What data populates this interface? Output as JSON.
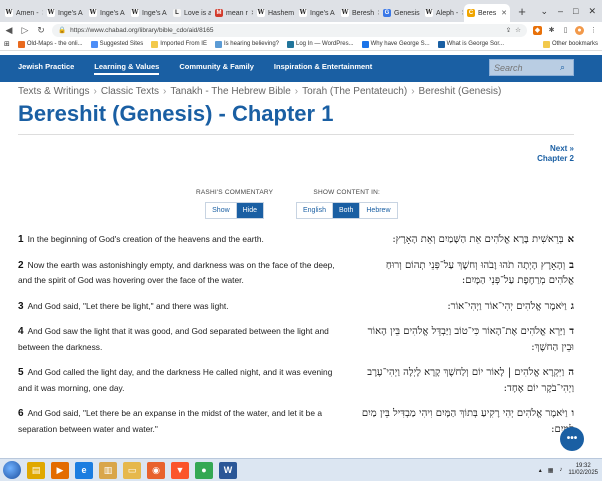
{
  "browser": {
    "tabs": [
      {
        "label": "Amen -",
        "color": "#ffffff",
        "glyph": "W"
      },
      {
        "label": "Inge's A",
        "color": "#ffffff",
        "glyph": "W"
      },
      {
        "label": "Inge's A",
        "color": "#ffffff",
        "glyph": "W"
      },
      {
        "label": "Inge's A",
        "color": "#ffffff",
        "glyph": "W"
      },
      {
        "label": "Love is a",
        "color": "#f5f5f5",
        "glyph": "L"
      },
      {
        "label": "mean r",
        "color": "#d23a2b",
        "glyph": "M"
      },
      {
        "label": "Hashem",
        "color": "#ffffff",
        "glyph": "W"
      },
      {
        "label": "Inge's A",
        "color": "#ffffff",
        "glyph": "W"
      },
      {
        "label": "Beresh",
        "color": "#ffffff",
        "glyph": "W"
      },
      {
        "label": "Genesis",
        "color": "#3b78e7",
        "glyph": "G"
      },
      {
        "label": "Aleph -",
        "color": "#ffffff",
        "glyph": "W"
      },
      {
        "label": "Beres",
        "color": "#f0a500",
        "glyph": "C"
      }
    ],
    "new_tab_label": "+",
    "window_controls": [
      "⌄",
      "–",
      "□",
      "✕"
    ],
    "url": "https://www.chabad.org/library/bible_cdo/aid/8165",
    "bookmarks": [
      {
        "label": "Old-Maps - the onli...",
        "color": "#e96a1f"
      },
      {
        "label": "Suggested Sites",
        "color": "#4e8ef7"
      },
      {
        "label": "Imported From IE",
        "color": "#f2c94c"
      },
      {
        "label": "Is hearing believing?",
        "color": "#5b9bd5"
      },
      {
        "label": "Log In — WordPres...",
        "color": "#21759b"
      },
      {
        "label": "Why have George S...",
        "color": "#1a73e8"
      },
      {
        "label": "What is George Sor...",
        "color": "#1a5fa3"
      }
    ],
    "other_bookmarks": "Other bookmarks"
  },
  "site_nav": {
    "items": [
      "Jewish Practice",
      "Learning & Values",
      "Community & Family",
      "Inspiration & Entertainment"
    ],
    "current_index": 1,
    "search_placeholder": "Search"
  },
  "breadcrumb": [
    "Texts & Writings",
    "Classic Texts",
    "Tanakh - The Hebrew Bible",
    "Torah (The Pentateuch)",
    "Bereshit (Genesis)"
  ],
  "page_title": "Bereshit (Genesis) - Chapter 1",
  "next_link": {
    "line1": "Next »",
    "line2": "Chapter 2"
  },
  "rashi": {
    "label": "RASHI'S COMMENTARY",
    "options": [
      "Show",
      "Hide"
    ],
    "active": "Hide"
  },
  "content": {
    "label": "SHOW CONTENT IN:",
    "options": [
      "English",
      "Both",
      "Hebrew"
    ],
    "active": "Both"
  },
  "verses": [
    {
      "num": "1",
      "english": "In the beginning of God's creation of the heavens and the earth.",
      "he_num": "א",
      "hebrew": "בְּרֵאשִׁית בָּרָא אֱלֹהִים אֵת הַשָּׁמַיִם וְאֵת הָאָרֶץ:"
    },
    {
      "num": "2",
      "english": "Now the earth was astonishingly empty, and darkness was on the face of the deep, and the spirit of God was hovering over the face of the water.",
      "he_num": "ב",
      "hebrew": "וְהָאָרֶץ הָיְתָה תֹהוּ וָבֹהוּ וְחשֶׁךְ עַל־פְּנֵי תְהוֹם וְרוּחַ אֱלֹהִים מְרַחֶפֶת עַל־פְּנֵי הַמָּיִם:"
    },
    {
      "num": "3",
      "english": "And God said, \"Let there be light,\" and there was light.",
      "he_num": "ג",
      "hebrew": "וַיֹּאמֶר אֱלֹהִים יְהִי־אוֹר וַיְהִי־אוֹר:"
    },
    {
      "num": "4",
      "english": "And God saw the light that it was good, and God separated between the light and between the darkness.",
      "he_num": "ד",
      "hebrew": "וַיַּרְא אֱלֹהִים אֶת־הָאוֹר כִּי־טוֹב וַיַּבְדֵּל אֱלֹהִים בֵּין הָאוֹר וּבֵין הַחשֶׁךְ:"
    },
    {
      "num": "5",
      "english": "And God called the light day, and the darkness He called night, and it was evening and it was morning, one day.",
      "he_num": "ה",
      "hebrew": "וַיִּקְרָא אֱלֹהִים | לָאוֹר יוֹם וְלַחשֶׁךְ קָרָא לָיְלָה וַיְהִי־עֶרֶב וַיְהִי־בֹקֶר יוֹם אֶחָד:"
    },
    {
      "num": "6",
      "english": "And God said, \"Let there be an expanse in the midst of the water, and let it be a separation between water and water.\"",
      "he_num": "ו",
      "hebrew": "וַיֹּאמֶר אֱלֹהִים יְהִי רָקִיעַ בְּתוֹךְ הַמָּיִם וִיהִי מַבְדִּיל בֵּין מַיִם לָמָיִם:"
    }
  ],
  "chat_button_icon": "chat-bubble-icon",
  "taskbar": {
    "apps": [
      {
        "name": "explorer",
        "color": "#e0a800",
        "glyph": "▤"
      },
      {
        "name": "media-player",
        "color": "#e36b00",
        "glyph": "▶"
      },
      {
        "name": "internet-explorer",
        "color": "#1b7de0",
        "glyph": "e"
      },
      {
        "name": "file-manager",
        "color": "#d9a64a",
        "glyph": "▥"
      },
      {
        "name": "folder",
        "color": "#e6b84c",
        "glyph": "▭"
      },
      {
        "name": "firefox",
        "color": "#e8622d",
        "glyph": "◉"
      },
      {
        "name": "brave",
        "color": "#fb542b",
        "glyph": "▼"
      },
      {
        "name": "chrome",
        "color": "#34a853",
        "glyph": "●"
      },
      {
        "name": "word",
        "color": "#2b5797",
        "glyph": "W"
      }
    ],
    "time": "19:32",
    "date": "11/02/2025"
  }
}
